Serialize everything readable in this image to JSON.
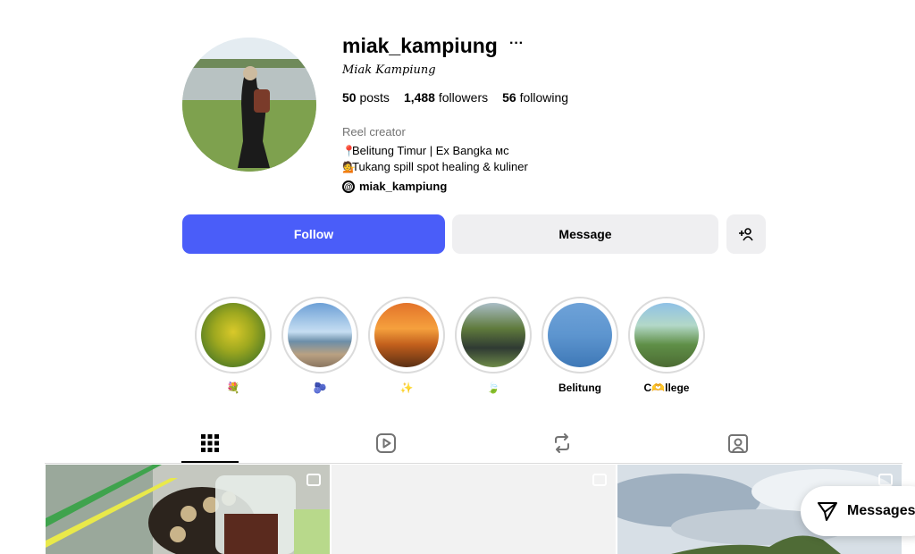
{
  "profile": {
    "username": "miak_kampiung",
    "full_name": "Miak Kampiung",
    "stats": {
      "posts": "50",
      "posts_label": "posts",
      "followers": "1,488",
      "followers_label": "followers",
      "following": "56",
      "following_label": "following"
    },
    "category": "Reel creator",
    "bio_line1": "Belitung Timur | Ex Bangka ᴍᴄ",
    "bio_line2": "Tukang spill spot healing & kuliner",
    "threads_handle": "miak_kampiung"
  },
  "actions": {
    "follow": "Follow",
    "message": "Message"
  },
  "highlights": [
    {
      "label": "💐"
    },
    {
      "label": "🫐"
    },
    {
      "label": "✨"
    },
    {
      "label": "🍃"
    },
    {
      "label": "Belitung"
    },
    {
      "label": "C🫶llege"
    }
  ],
  "messages_pill": {
    "label": "Messages"
  },
  "colors": {
    "accent": "#4a5df9",
    "button_gray": "#efeff1",
    "muted": "#737373"
  }
}
